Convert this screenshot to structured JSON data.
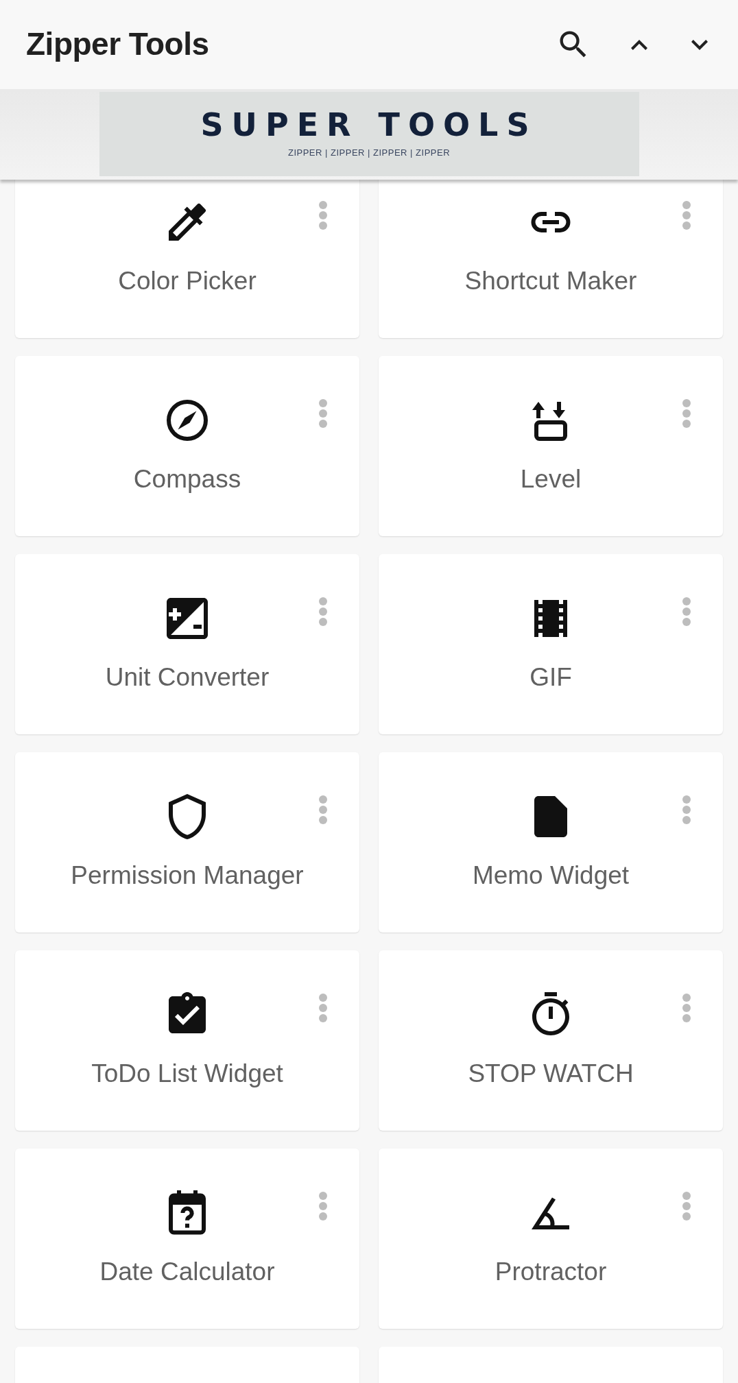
{
  "app_bar": {
    "title": "Zipper Tools"
  },
  "banner": {
    "title": "SUPER TOOLS",
    "subtitle": "ZIPPER | ZIPPER | ZIPPER | ZIPPER"
  },
  "tools": [
    {
      "label": "Color Picker"
    },
    {
      "label": "Shortcut Maker"
    },
    {
      "label": "Compass"
    },
    {
      "label": "Level"
    },
    {
      "label": "Unit Converter"
    },
    {
      "label": "GIF"
    },
    {
      "label": "Permission Manager"
    },
    {
      "label": "Memo Widget"
    },
    {
      "label": "ToDo List Widget"
    },
    {
      "label": "STOP WATCH"
    },
    {
      "label": "Date Calculator"
    },
    {
      "label": "Protractor"
    }
  ]
}
